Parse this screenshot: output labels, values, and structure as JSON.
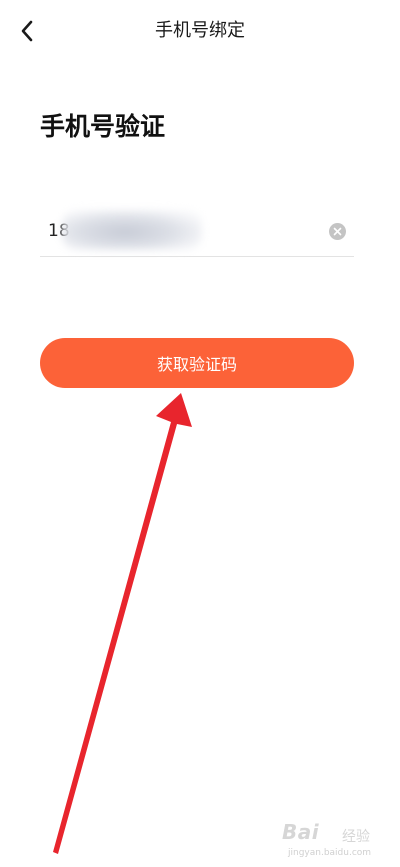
{
  "nav": {
    "title": "手机号绑定",
    "back_icon": "chevron-left-icon"
  },
  "page": {
    "heading": "手机号验证"
  },
  "phone_field": {
    "value": "18",
    "clear_icon": "clear-circle-icon"
  },
  "action": {
    "get_code_label": "获取验证码"
  },
  "annotation": {
    "arrow_color": "#e8252d",
    "arrow_icon": "arrow-up-icon"
  },
  "watermark": {
    "brand": "Bai",
    "sub": "经验",
    "url": "jingyan.baidu.com"
  },
  "colors": {
    "accent": "#fc6238",
    "text_primary": "#111111",
    "divider": "#e3e3e3",
    "clear_icon_bg": "#c4c4c4"
  }
}
